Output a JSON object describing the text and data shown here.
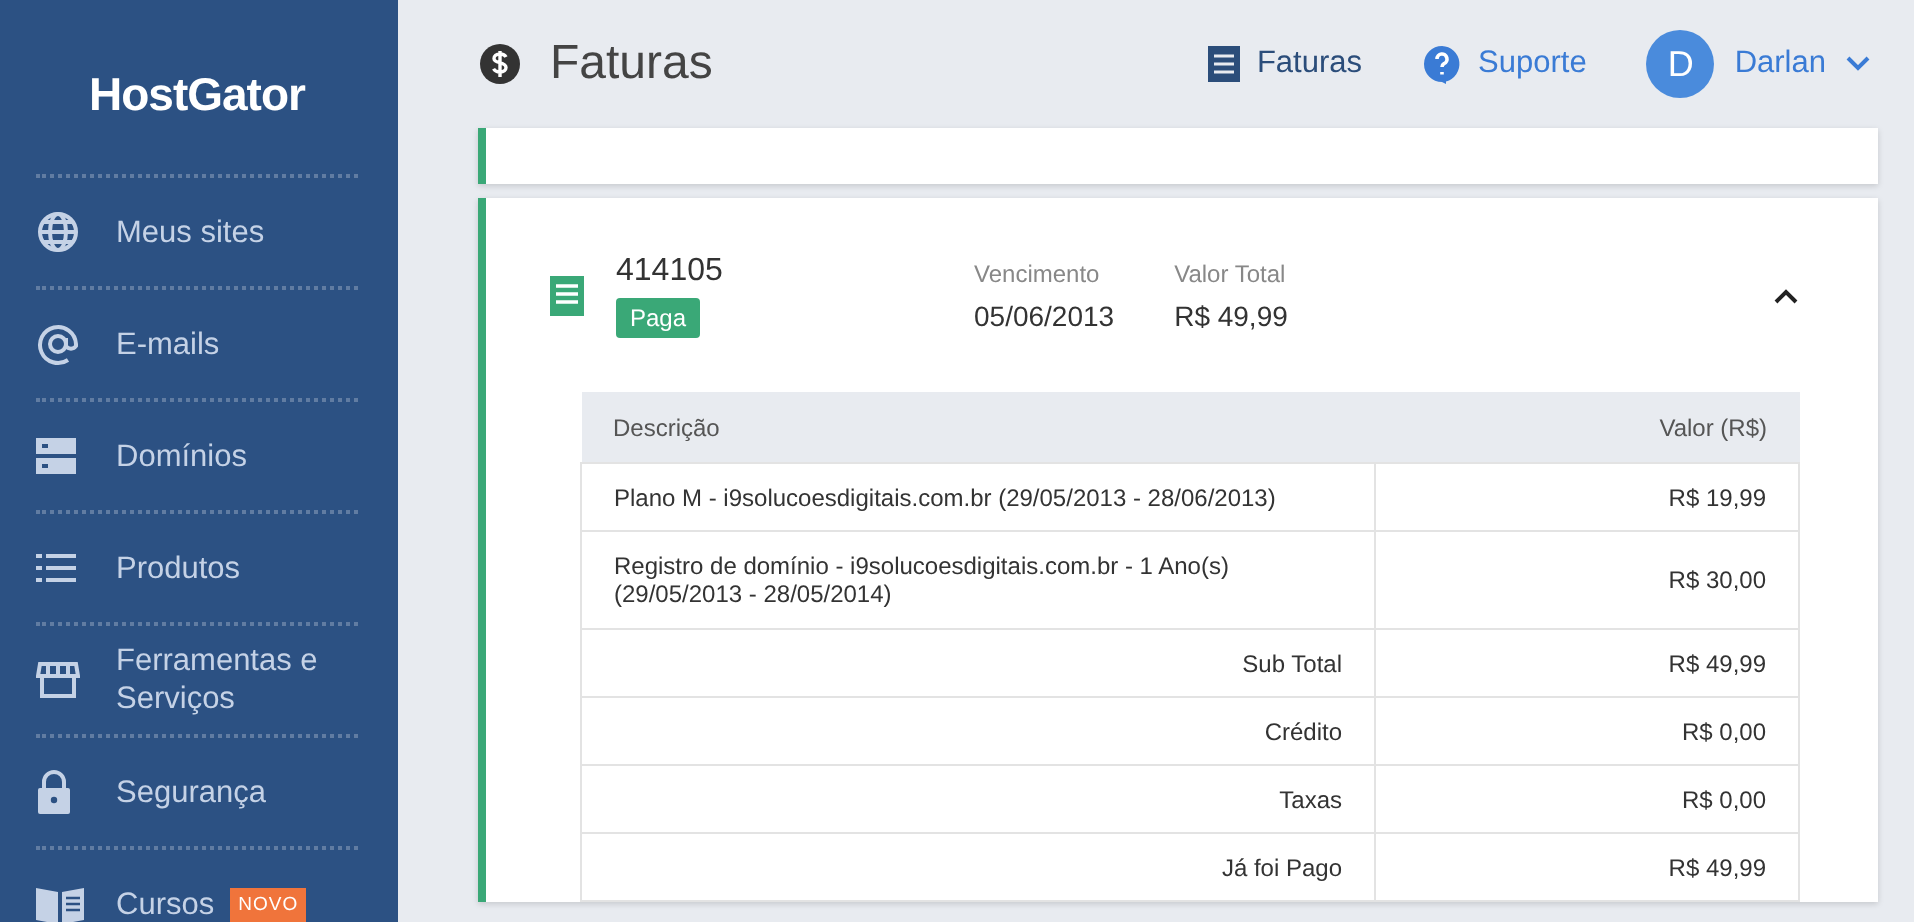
{
  "sidebar": {
    "logo": "HostGator",
    "items": [
      {
        "label": "Meus sites"
      },
      {
        "label": "E-mails"
      },
      {
        "label": "Domínios"
      },
      {
        "label": "Produtos"
      },
      {
        "label": "Ferramentas e Serviços"
      },
      {
        "label": "Segurança"
      },
      {
        "label": "Cursos",
        "badge": "NOVO"
      }
    ]
  },
  "header": {
    "title": "Faturas",
    "nav": [
      {
        "label": "Faturas",
        "selected": true
      },
      {
        "label": "Suporte",
        "selected": false
      }
    ],
    "user": {
      "initial": "D",
      "name": "Darlan"
    }
  },
  "invoice": {
    "number": "414105",
    "status": "Paga",
    "expanded": true,
    "fields": [
      {
        "label": "Vencimento",
        "value": "05/06/2013"
      },
      {
        "label": "Valor Total",
        "value": "R$ 49,99"
      }
    ],
    "table": {
      "columns": [
        "Descrição",
        "Valor (R$)"
      ],
      "rows": [
        {
          "kind": "item",
          "description": "Plano M - i9solucoesdigitais.com.br (29/05/2013 - 28/06/2013)",
          "value": "R$ 19,99"
        },
        {
          "kind": "item",
          "description": "Registro de domínio - i9solucoesdigitais.com.br - 1 Ano(s) (29/05/2013 - 28/05/2014)",
          "value": "R$ 30,00"
        },
        {
          "kind": "total",
          "description": "Sub Total",
          "value": "R$ 49,99"
        },
        {
          "kind": "total",
          "description": "Crédito",
          "value": "R$ 0,00"
        },
        {
          "kind": "total",
          "description": "Taxas",
          "value": "R$ 0,00"
        },
        {
          "kind": "total",
          "description": "Já foi Pago",
          "value": "R$ 49,99"
        }
      ]
    }
  }
}
